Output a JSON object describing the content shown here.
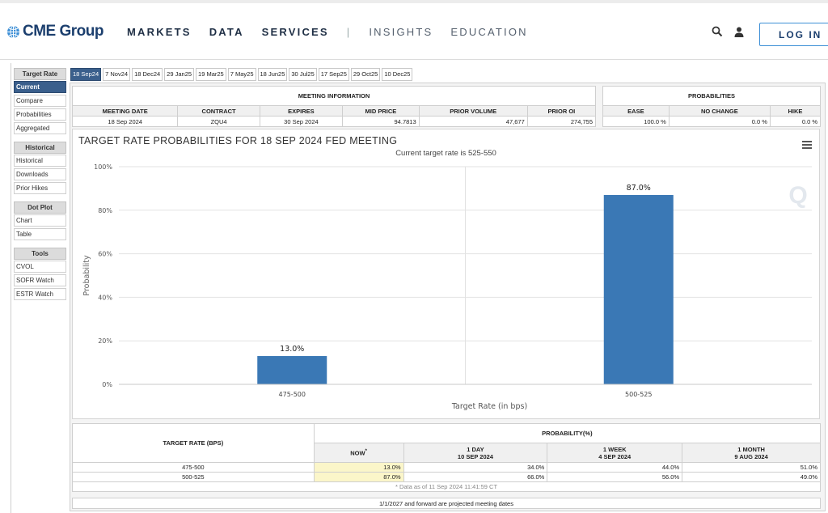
{
  "header": {
    "logo_text": "CME Group",
    "nav": [
      "MARKETS",
      "DATA",
      "SERVICES",
      "|",
      "INSIGHTS",
      "EDUCATION"
    ],
    "login_label": "LOG IN",
    "search_icon": "search-icon",
    "user_icon": "user-icon"
  },
  "sidebar": {
    "sections": [
      {
        "title": "Target Rate",
        "items": [
          "Current",
          "Compare",
          "Probabilities",
          "Aggregated"
        ]
      },
      {
        "title": "Historical",
        "items": [
          "Historical",
          "Downloads",
          "Prior Hikes"
        ]
      },
      {
        "title": "Dot Plot",
        "items": [
          "Chart",
          "Table"
        ]
      },
      {
        "title": "Tools",
        "items": [
          "CVOL",
          "SOFR Watch",
          "ESTR Watch"
        ]
      }
    ]
  },
  "tabs": [
    "18 Sep24",
    "7 Nov24",
    "18 Dec24",
    "29 Jan25",
    "19 Mar25",
    "7 May25",
    "18 Jun25",
    "30 Jul25",
    "17 Sep25",
    "29 Oct25",
    "10 Dec25"
  ],
  "meeting_info": {
    "title": "MEETING INFORMATION",
    "headers": [
      "MEETING DATE",
      "CONTRACT",
      "EXPIRES",
      "MID PRICE",
      "PRIOR VOLUME",
      "PRIOR OI"
    ],
    "values": [
      "18 Sep 2024",
      "ZQU4",
      "30 Sep 2024",
      "94.7813",
      "47,677",
      "274,755"
    ]
  },
  "probabilities": {
    "title": "PROBABILITIES",
    "headers": [
      "EASE",
      "NO CHANGE",
      "HIKE"
    ],
    "values": [
      "100.0 %",
      "0.0 %",
      "0.0 %"
    ]
  },
  "chart": {
    "title": "TARGET RATE PROBABILITIES FOR 18 SEP 2024 FED MEETING",
    "subtitle": "Current target rate is 525-550",
    "watermark": "Q"
  },
  "chart_data": {
    "type": "bar",
    "title": "TARGET RATE PROBABILITIES FOR 18 SEP 2024 FED MEETING",
    "subtitle": "Current target rate is 525-550",
    "categories": [
      "475-500",
      "500-525"
    ],
    "values": [
      13.0,
      87.0
    ],
    "data_labels": [
      "13.0%",
      "87.0%"
    ],
    "xlabel": "Target Rate (in bps)",
    "ylabel": "Probability",
    "ylim": [
      0,
      100
    ],
    "yticks": [
      "0%",
      "20%",
      "40%",
      "60%",
      "80%",
      "100%"
    ],
    "bar_color": "#3a78b5",
    "grid": true
  },
  "bottom_table": {
    "target_header": "TARGET RATE (BPS)",
    "prob_header": "PROBABILITY(%)",
    "cols": [
      {
        "line1": "NOW",
        "line2": "",
        "sup": "*"
      },
      {
        "line1": "1 DAY",
        "line2": "10 SEP 2024"
      },
      {
        "line1": "1 WEEK",
        "line2": "4 SEP 2024"
      },
      {
        "line1": "1 MONTH",
        "line2": "9 AUG 2024"
      }
    ],
    "rows": [
      {
        "rate": "475-500",
        "values": [
          "13.0%",
          "34.0%",
          "44.0%",
          "51.0%"
        ]
      },
      {
        "rate": "500-525",
        "values": [
          "87.0%",
          "66.0%",
          "56.0%",
          "49.0%"
        ]
      }
    ],
    "note": "* Data as of 11 Sep 2024 11:41:59 CT"
  },
  "footer_note": "1/1/2027 and forward are projected meeting dates",
  "colors": {
    "accent": "#3a5f8c",
    "bar": "#3a78b5",
    "brand": "#1c3f6e",
    "now_highlight": "#fbf6c9"
  }
}
